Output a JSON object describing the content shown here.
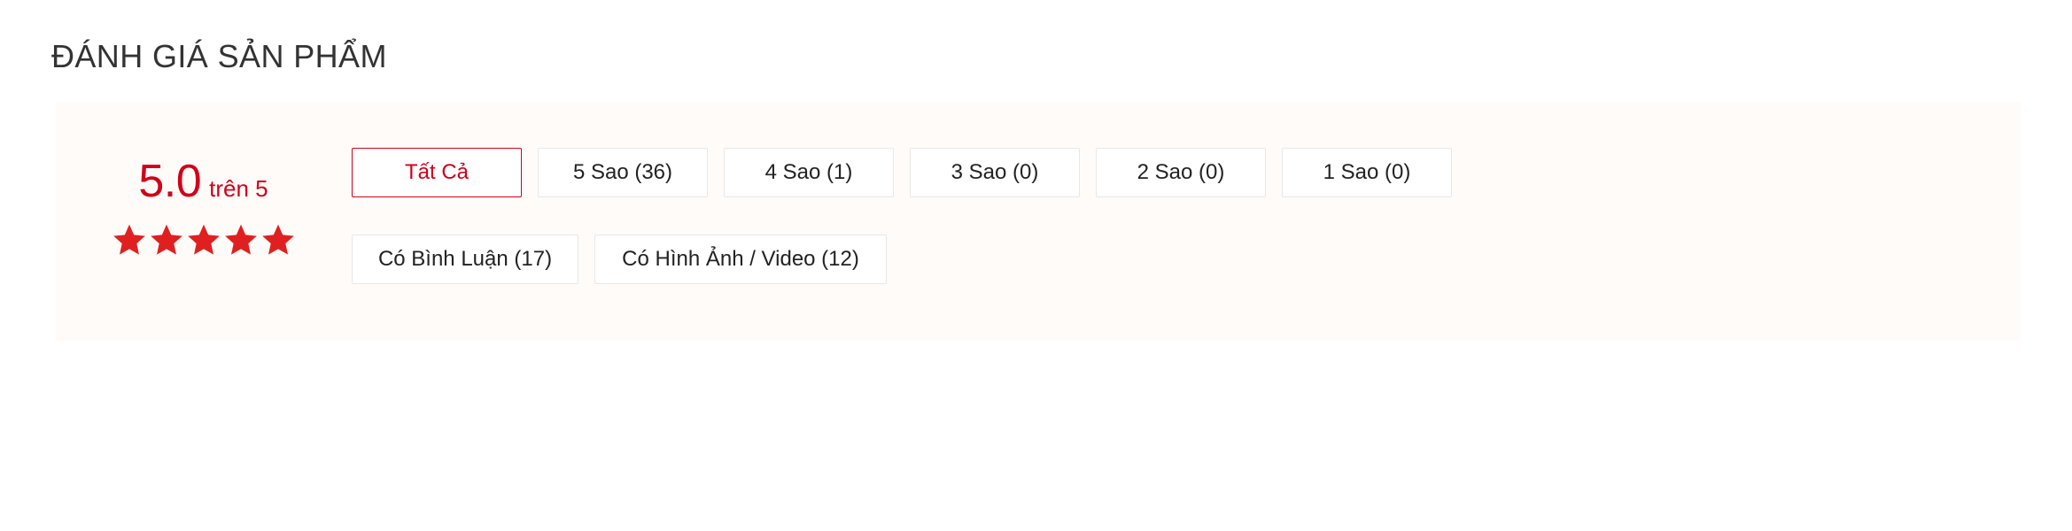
{
  "section": {
    "title": "ĐÁNH GIÁ SẢN PHẨM"
  },
  "rating_summary": {
    "score": "5.0",
    "out_of_label": "trên 5",
    "max_score": 5,
    "filled_stars": 5,
    "total_stars": 5,
    "star_icon": "star-icon"
  },
  "filters": {
    "rating_row": [
      {
        "label": "Tất Cả",
        "active": true,
        "size": "normal"
      },
      {
        "label": "5 Sao (36)",
        "active": false,
        "size": "normal"
      },
      {
        "label": "4 Sao (1)",
        "active": false,
        "size": "normal"
      },
      {
        "label": "3 Sao (0)",
        "active": false,
        "size": "normal"
      },
      {
        "label": "2 Sao (0)",
        "active": false,
        "size": "normal"
      },
      {
        "label": "1 Sao (0)",
        "active": false,
        "size": "normal"
      }
    ],
    "content_row": [
      {
        "label": "Có Bình Luận (17)",
        "active": false,
        "size": "wide"
      },
      {
        "label": "Có Hình Ảnh / Video (12)",
        "active": false,
        "size": "wider"
      }
    ]
  },
  "colors": {
    "accent_red": "#d0011b",
    "panel_background": "#fffbf8",
    "page_background": "#ffffff",
    "title_text": "#333333",
    "button_text": "#222222",
    "button_border": "#e8e8e8"
  }
}
